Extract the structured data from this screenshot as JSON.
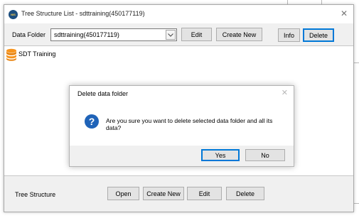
{
  "window": {
    "title": "Tree Structure List - sdttraining(450177119)",
    "logo_text": "NIS"
  },
  "toolbar": {
    "data_folder_label": "Data Folder",
    "data_folder_value": "sdttraining(450177119)",
    "edit_label": "Edit",
    "create_new_label": "Create New",
    "info_label": "Info",
    "delete_label": "Delete"
  },
  "tree": {
    "items": [
      {
        "label": "SDT Training"
      }
    ]
  },
  "bottom": {
    "label": "Tree Structure",
    "open_label": "Open",
    "create_new_label": "Create New",
    "edit_label": "Edit",
    "delete_label": "Delete"
  },
  "dialog": {
    "title": "Delete data folder",
    "message": "Are you sure you want to delete selected data folder and all its data?",
    "yes_label": "Yes",
    "no_label": "No"
  },
  "colors": {
    "accent": "#0078d7",
    "question_icon": "#1f63b8",
    "db_icon": "#f7941d"
  }
}
